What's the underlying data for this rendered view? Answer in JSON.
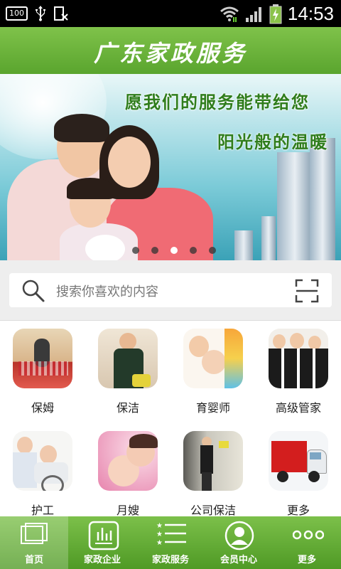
{
  "status_bar": {
    "notification_badge": "100",
    "time": "14:53"
  },
  "header": {
    "title": "广东家政服务"
  },
  "banner": {
    "slogan_line1": "愿我们的服务能带给您",
    "slogan_line2": "阳光般的温暖",
    "carousel_total": 5,
    "carousel_active_index": 2
  },
  "search": {
    "placeholder": "搜索你喜欢的内容"
  },
  "categories": [
    {
      "label": "保姆",
      "icon": "nanny-photo"
    },
    {
      "label": "保洁",
      "icon": "cleaner-photo"
    },
    {
      "label": "育婴师",
      "icon": "childcare-photo"
    },
    {
      "label": "高级管家",
      "icon": "butler-photo"
    },
    {
      "label": "护工",
      "icon": "caregiver-photo"
    },
    {
      "label": "月嫂",
      "icon": "maternity-nurse-photo"
    },
    {
      "label": "公司保洁",
      "icon": "office-cleaning-photo"
    },
    {
      "label": "更多",
      "icon": "truck-photo"
    }
  ],
  "tabbar": {
    "active": "首页",
    "tabs": [
      {
        "label": "首页",
        "icon": "home-icon"
      },
      {
        "label": "家政企业",
        "icon": "company-icon"
      },
      {
        "label": "家政服务",
        "icon": "service-list-icon"
      },
      {
        "label": "会员中心",
        "icon": "member-icon"
      },
      {
        "label": "更多",
        "icon": "more-icon"
      }
    ]
  },
  "colors": {
    "brand_green": "#5aa52e",
    "status_bar": "#000000",
    "search_bg": "#eeeeee"
  }
}
